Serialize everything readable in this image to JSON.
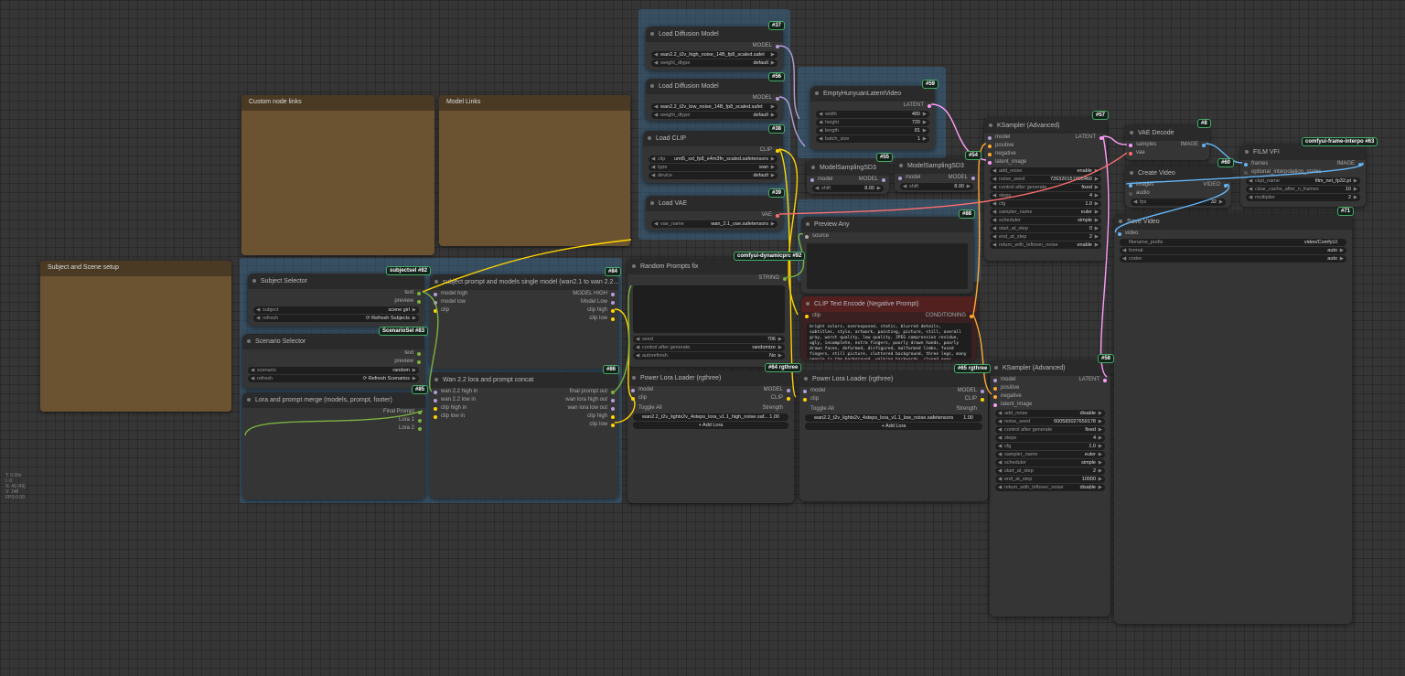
{
  "colors": {
    "model": "#b39ddb",
    "clip": "#ffd500",
    "latent": "#ff9cf9",
    "image": "#64b5f6",
    "conditioning": "#ffa931",
    "vae": "#ff6e6e",
    "string": "#7cb342",
    "int": "#29699c",
    "video": "#64b5f6"
  },
  "groups": [
    "",
    "",
    "",
    "",
    ""
  ],
  "notes": {
    "custom_links": "Custom node links",
    "model_links": "Model Links",
    "subject_scene": "Subject and Scene setup"
  },
  "badges": {
    "n37": "#37",
    "n56": "#56",
    "n38": "#38",
    "n39": "#39",
    "n59": "#59",
    "n55": "#55",
    "n54": "#54",
    "n57": "#57",
    "n8": "#8",
    "n60": "#60",
    "n63": "comfyui-frame-interpo #63",
    "n71": "#71",
    "n82": "subjectsel #82",
    "n83": "ScenarioSel #83",
    "n84": "#84",
    "n85": "#85",
    "n86": "#86",
    "n92": "comfyui-dynamicprc #92",
    "n88": "#88",
    "n64": "#64 rgthree",
    "n65": "#65 rgthree",
    "n58": "#58"
  },
  "load_diffusion_high": {
    "title": "Load Diffusion Model",
    "out": "MODEL",
    "unet_name": "wan2.2_t2v_high_noise_14B_fp8_scaled.safet",
    "weight_dtype_label": "weight_dtype",
    "weight_dtype": "default"
  },
  "load_diffusion_low": {
    "title": "Load Diffusion Model",
    "out": "MODEL",
    "unet_name": "wan2.2_t2v_low_noise_14B_fp8_scaled.safet",
    "weight_dtype_label": "weight_dtype",
    "weight_dtype": "default"
  },
  "load_clip": {
    "title": "Load CLIP",
    "out": "CLIP",
    "clip_label": "clip",
    "clip_name": "umt5_xxl_fp8_e4m3fn_scaled.safetensors",
    "type_label": "type",
    "type": "wan",
    "device_label": "device",
    "device": "default"
  },
  "load_vae": {
    "title": "Load VAE",
    "out": "VAE",
    "vae_label": "vae_name",
    "vae_name": "wan_2.1_vae.safetensors"
  },
  "empty_latent": {
    "title": "EmptyHunyuanLatentVideo",
    "out": "LATENT",
    "widgets": [
      {
        "label": "width",
        "value": "480"
      },
      {
        "label": "height",
        "value": "720"
      },
      {
        "label": "length",
        "value": "81"
      },
      {
        "label": "batch_size",
        "value": "1"
      }
    ]
  },
  "model_sampling_1": {
    "title": "ModelSamplingSD3",
    "in": "model",
    "out": "MODEL",
    "shift_label": "shift",
    "shift": "8.00"
  },
  "model_sampling_2": {
    "title": "ModelSamplingSD3",
    "in": "model",
    "out": "MODEL",
    "shift_label": "shift",
    "shift": "8.00"
  },
  "ksampler_1": {
    "title": "KSampler (Advanced)",
    "out": "LATENT",
    "inputs": [
      "model",
      "positive",
      "negative",
      "latent_image"
    ],
    "widgets": [
      {
        "label": "add_noise",
        "value": "enable"
      },
      {
        "label": "noise_seed",
        "value": "726320151985460"
      },
      {
        "label": "control after generate",
        "value": "fixed"
      },
      {
        "label": "steps",
        "value": "4"
      },
      {
        "label": "cfg",
        "value": "1.0"
      },
      {
        "label": "sampler_name",
        "value": "euler"
      },
      {
        "label": "scheduler",
        "value": "simple"
      },
      {
        "label": "start_at_step",
        "value": "0"
      },
      {
        "label": "end_at_step",
        "value": "2"
      },
      {
        "label": "return_with_leftover_noise",
        "value": "enable"
      }
    ]
  },
  "ksampler_2": {
    "title": "KSampler (Advanced)",
    "out": "LATENT",
    "inputs": [
      "model",
      "positive",
      "negative",
      "latent_image"
    ],
    "widgets": [
      {
        "label": "add_noise",
        "value": "disable"
      },
      {
        "label": "noise_seed",
        "value": "600583027659178"
      },
      {
        "label": "control after generate",
        "value": "fixed"
      },
      {
        "label": "steps",
        "value": "4"
      },
      {
        "label": "cfg",
        "value": "1.0"
      },
      {
        "label": "sampler_name",
        "value": "euler"
      },
      {
        "label": "scheduler",
        "value": "simple"
      },
      {
        "label": "start_at_step",
        "value": "2"
      },
      {
        "label": "end_at_step",
        "value": "10000"
      },
      {
        "label": "return_with_leftover_noise",
        "value": "disable"
      }
    ]
  },
  "vae_decode": {
    "title": "VAE Decode",
    "in1": "samples",
    "in2": "vae",
    "out": "IMAGE"
  },
  "create_video": {
    "title": "Create Video",
    "in1": "images",
    "in2": "audio",
    "out": "VIDEO",
    "fps_label": "fps",
    "fps": "32"
  },
  "film_vfi": {
    "title": "FILM VFI",
    "in1": "frames",
    "in2": "optional_interpolation_states",
    "out": "IMAGE",
    "widgets": [
      {
        "label": "ckpt_name",
        "value": "film_net_fp32.pt"
      },
      {
        "label": "clear_cache_after_n_frames",
        "value": "10"
      },
      {
        "label": "multiplier",
        "value": "2"
      }
    ]
  },
  "save_video": {
    "title": "Save Video",
    "in": "video",
    "widgets": [
      {
        "label": "filename_prefix",
        "value": "video/ComfyUI"
      },
      {
        "label": "format",
        "value": "auto"
      },
      {
        "label": "codec",
        "value": "auto"
      }
    ]
  },
  "preview_any": {
    "title": "Preview Any",
    "in": "source"
  },
  "clip_negative": {
    "title": "CLIP Text Encode (Negative Prompt)",
    "in": "clip",
    "out": "CONDITIONING",
    "text": "bright colors, overexposed, static, blurred details, subtitles, style, artwork, painting, picture, still, overall gray, worst quality, low quality, JPEG compression residue, ugly, incomplete, extra fingers, poorly drawn hands, poorly drawn faces, deformed, disfigured, malformed limbs, fused fingers, still picture, cluttered background, three legs, many people in the background, walking backwards, closed eyes"
  },
  "random_prompts": {
    "title": "Random Prompts fix",
    "out": "STRING",
    "widgets": [
      {
        "label": "seed",
        "value": "706"
      },
      {
        "label": "control after generate",
        "value": "randomize"
      },
      {
        "label": "autorefresh",
        "value": "No"
      }
    ]
  },
  "subject_selector": {
    "title": "Subject Selector",
    "out1": "text",
    "out2": "preview",
    "subject_label": "subject",
    "subject": "scene girl",
    "refresh_label": "refresh",
    "refresh": "⟳ Refresh Subjects"
  },
  "scenario_selector": {
    "title": "Scenario Selector",
    "out1": "text",
    "out2": "preview",
    "scenario_label": "scenario",
    "scenario": "random",
    "refresh_label": "refresh",
    "refresh": "⟳ Refresh Scenarios"
  },
  "lora_prompt_merge": {
    "title": "Lora and prompt merge (models, prompt, footer)",
    "out1": "Final Prompt",
    "out2": "Lora 1",
    "out3": "Lora 2"
  },
  "subject_prompt": {
    "title": "subject prompt and models single model (wan2.1 to wan 2.2...",
    "inputs": [
      "model high",
      "model low",
      "clip"
    ],
    "outputs": [
      "MODEL HIGH",
      "Model Low",
      "clip high",
      "clip low"
    ]
  },
  "wan_lora": {
    "title": "Wan 2.2 lora and prompt concat",
    "inputs": [
      "wan 2.2 high in",
      "wan 2.2 low in",
      "clip high in",
      "clip low in"
    ],
    "outputs": [
      "final prompt out",
      "wan lora high out",
      "wan lora low out",
      "clip high",
      "clip low"
    ]
  },
  "power_lora_high": {
    "title": "Power Lora Loader (rgthree)",
    "in1": "model",
    "in2": "clip",
    "out1": "MODEL",
    "out2": "CLIP",
    "toggle_all": "Toggle All",
    "strength_label": "Strength",
    "lora": "wan2.2_t2v_lightx2v_4steps_lora_v1.1_high_noise.saf...",
    "strength": "1.00",
    "add": "+ Add Lora"
  },
  "power_lora_low": {
    "title": "Power Lora Loader (rgthree)",
    "in1": "model",
    "in2": "clip",
    "out1": "MODEL",
    "out2": "CLIP",
    "toggle_all": "Toggle All",
    "strength_label": "Strength",
    "lora": "wan2.2_t2v_lightx2v_4steps_lora_v1.1_low_noise.safetensors",
    "strength": "1.00",
    "add": "+ Add Lora"
  },
  "sidebar_stats": "T: 0.00s\nI: 0\nN: 49 [49]\nV: 148\nFPS:0.00"
}
